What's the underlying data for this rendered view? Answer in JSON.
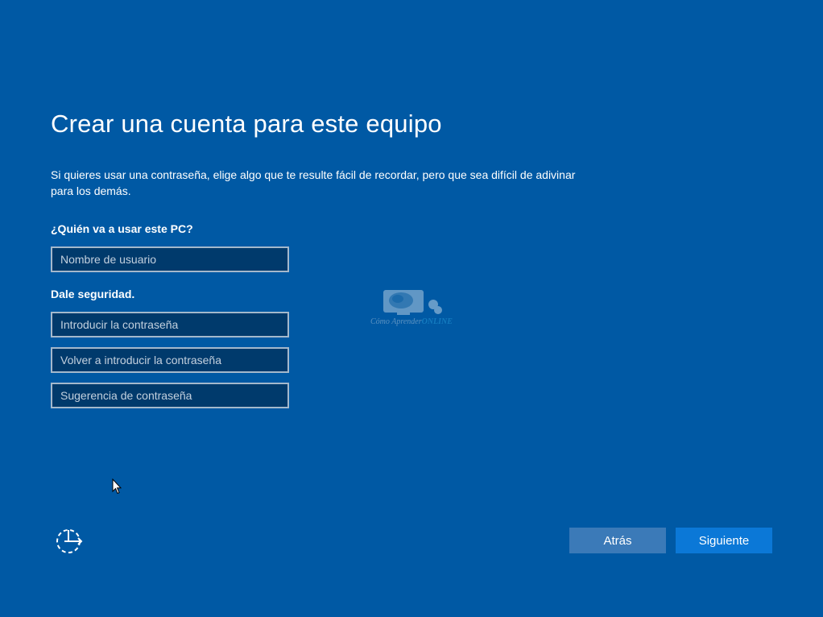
{
  "page": {
    "title": "Crear una cuenta para este equipo",
    "description": "Si quieres usar una contraseña, elige algo que te resulte fácil de recordar, pero que sea difícil de adivinar para los demás."
  },
  "form": {
    "who_label": "¿Quién va a usar este PC?",
    "username": {
      "value": "",
      "placeholder": "Nombre de usuario"
    },
    "security_label": "Dale seguridad.",
    "password": {
      "value": "",
      "placeholder": "Introducir la contraseña"
    },
    "password_confirm": {
      "value": "",
      "placeholder": "Volver a introducir la contraseña"
    },
    "password_hint": {
      "value": "",
      "placeholder": "Sugerencia de contraseña"
    }
  },
  "watermark": {
    "text_main": "Cómo Aprender",
    "text_accent": "ONLINE"
  },
  "footer": {
    "ease_of_access_icon": "ease-of-access-icon",
    "back_label": "Atrás",
    "next_label": "Siguiente"
  },
  "colors": {
    "background": "#0059a4",
    "field_background": "#003a6c",
    "field_border": "#a4b8cc",
    "back_button": "#3b7ab8",
    "next_button": "#0b78d7"
  }
}
